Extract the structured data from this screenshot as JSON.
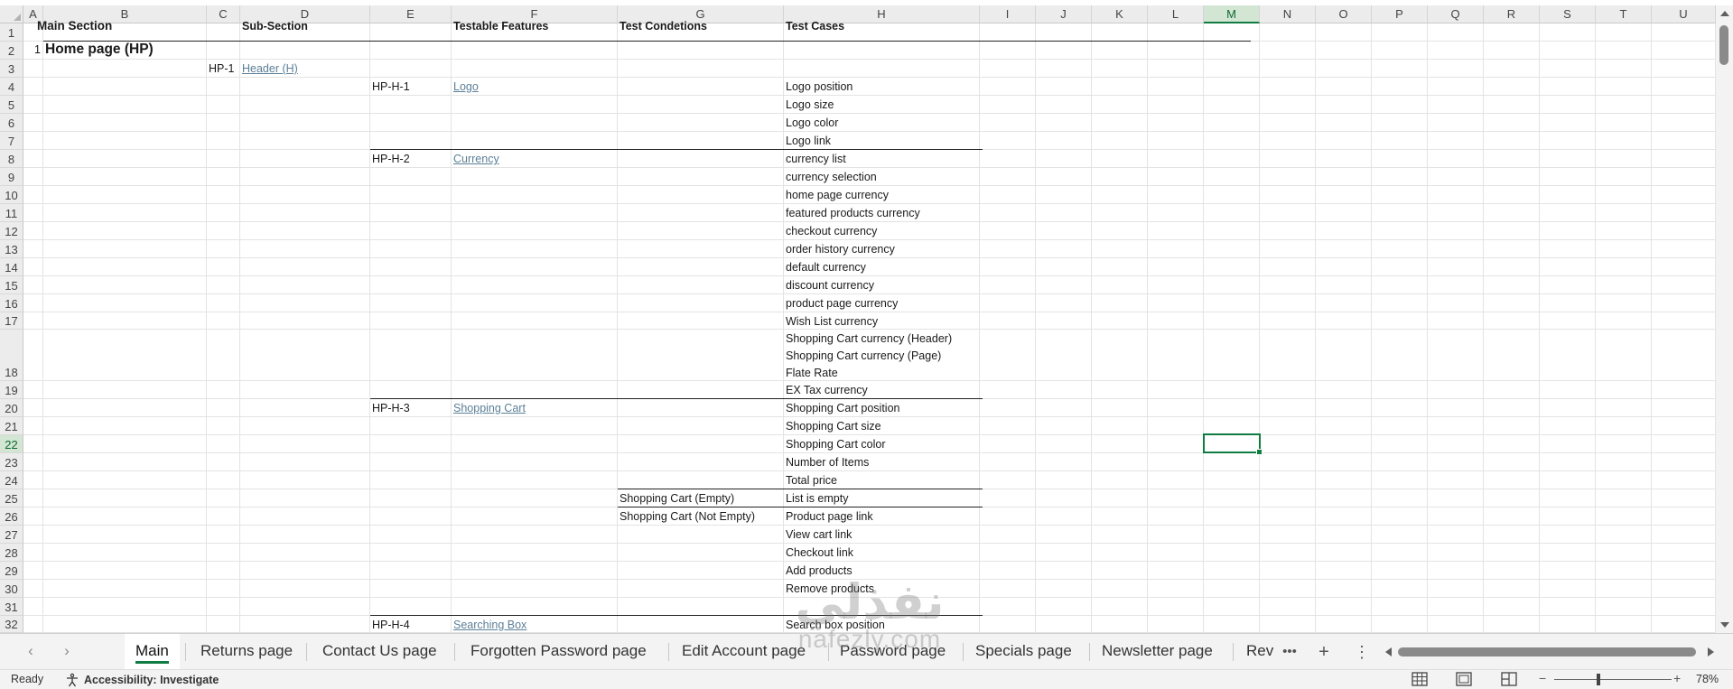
{
  "columns": [
    "A",
    "B",
    "C",
    "D",
    "E",
    "F",
    "G",
    "H",
    "I",
    "J",
    "K",
    "L",
    "M",
    "N",
    "O",
    "P",
    "Q",
    "R",
    "S",
    "T",
    "U"
  ],
  "selected_column": "M",
  "rows": [
    "1",
    "2",
    "3",
    "4",
    "5",
    "6",
    "7",
    "8",
    "9",
    "10",
    "11",
    "12",
    "13",
    "14",
    "15",
    "16",
    "17",
    "18",
    "19",
    "20",
    "21",
    "22",
    "23",
    "24",
    "25",
    "26",
    "27",
    "28",
    "29",
    "30",
    "31",
    "32"
  ],
  "selected_row": "22",
  "headers": {
    "main_section": "Main Section",
    "sub_section": "Sub-Section",
    "testable_features": "Testable Features",
    "test_conditions": "Test Condetions",
    "test_cases": "Test Cases"
  },
  "section": {
    "number": "1",
    "title": "Home page (HP)"
  },
  "subsection": {
    "id": "HP-1",
    "name": "Header (H)"
  },
  "features": [
    {
      "id": "HP-H-1",
      "name": "Logo"
    },
    {
      "id": "HP-H-2",
      "name": "Currency"
    },
    {
      "id": "HP-H-3",
      "name": "Shopping Cart"
    },
    {
      "id": "HP-H-4",
      "name": "Searching Box"
    }
  ],
  "conditions": [
    "Shopping Cart  (Empty)",
    "Shopping Cart  (Not Empty)"
  ],
  "test_cases": [
    "Logo position",
    "Logo size",
    "Logo color",
    "Logo link",
    "currency list",
    "currency selection",
    "home page currency",
    "featured products currency",
    "checkout currency",
    "order history currency",
    "default currency",
    "discount currency",
    "product page currency",
    "Wish List currency",
    "Shopping Cart currency  (Header)",
    "Shopping Cart currency  (Page)",
    "Flate Rate",
    "EX Tax currency",
    "Shopping Cart  position",
    "Shopping Cart  size",
    "Shopping Cart  color",
    "Number of Items",
    "Total price",
    "List is empty",
    "Product page link",
    "View cart link",
    "Checkout link",
    "Add products",
    "Remove products",
    "Search box  position"
  ],
  "sheet_tabs": [
    "Main",
    "Returns page",
    "Contact Us page",
    "Forgotten Password page",
    "Edit Account page",
    "Password page",
    "Specials page",
    "Newsletter page",
    "Rev"
  ],
  "active_tab": "Main",
  "status": {
    "ready": "Ready",
    "accessibility": "Accessibility: Investigate",
    "zoom": "78%"
  },
  "watermark": {
    "arabic": "نفذلي",
    "latin": "nafezly.com"
  },
  "colors": {
    "accent": "#107c41",
    "link": "#5b7f97"
  }
}
